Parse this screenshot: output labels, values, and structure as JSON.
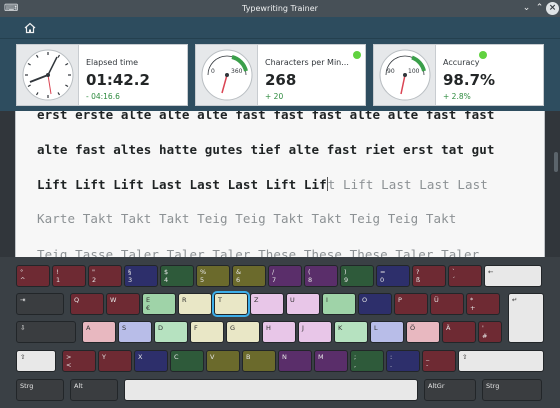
{
  "window": {
    "title": "Typewriting Trainer"
  },
  "stats": {
    "elapsed": {
      "label": "Elapsed time",
      "value": "01:42.2",
      "delta": "- 04:16.6"
    },
    "cpm": {
      "label": "Characters per Min...",
      "value": "268",
      "delta": "+ 20",
      "gauge_ticks": [
        "0",
        "360"
      ],
      "status_color": "#60d23f"
    },
    "accuracy": {
      "label": "Accuracy",
      "value": "98.7%",
      "delta": "+ 2.8%",
      "gauge_ticks": [
        "90",
        "100"
      ],
      "status_color": "#60d23f"
    }
  },
  "lesson": {
    "lines": [
      {
        "typed": "erst erste alte alte alte fast fast fast alte alte fast fast",
        "pending": ""
      },
      {
        "typed": "alte fast altes hatte gutes tief alte fast riet erst tat gut",
        "pending": ""
      },
      {
        "typed": "Lift Lift Lift Last Last Last Lift Lif",
        "pending": "t Lift Last Last Last"
      },
      {
        "typed": "",
        "pending": "Karte Takt Takt Takt Teig Teig Takt Takt Teig Teig Takt"
      },
      {
        "typed": "",
        "pending": "Teig Tasse Taler Taler Taler These These These Taler Taler"
      }
    ]
  },
  "keyboard": {
    "rows": [
      [
        {
          "label": "°",
          "sub": "^",
          "color": "#6e2a33"
        },
        {
          "label": "!",
          "sub": "1",
          "color": "#6e2a33"
        },
        {
          "label": "\"",
          "sub": "2",
          "color": "#6e2a33"
        },
        {
          "label": "§",
          "sub": "3",
          "color": "#2d2f6b"
        },
        {
          "label": "$",
          "sub": "4",
          "color": "#2e5a3a"
        },
        {
          "label": "%",
          "sub": "5",
          "color": "#6b6a2c"
        },
        {
          "label": "&",
          "sub": "6",
          "color": "#6b6a2c"
        },
        {
          "label": "/",
          "sub": "7",
          "color": "#5a2e6a"
        },
        {
          "label": "(",
          "sub": "8",
          "color": "#5a2e6a"
        },
        {
          "label": ")",
          "sub": "9",
          "color": "#2e5a3a"
        },
        {
          "label": "=",
          "sub": "0",
          "color": "#2d2f6b"
        },
        {
          "label": "?",
          "sub": "ß",
          "color": "#6e2a33"
        },
        {
          "label": "`",
          "sub": "´",
          "color": "#6e2a33"
        },
        {
          "label": "←",
          "sub": "",
          "color": "#e8e8e8",
          "light": true
        }
      ],
      [
        {
          "label": "⇥",
          "sub": "",
          "color": "#3a3d40"
        },
        {
          "label": "Q",
          "sub": "",
          "color": "#6e2a33"
        },
        {
          "label": "W",
          "sub": "",
          "color": "#6e2a33"
        },
        {
          "label": "E",
          "sub": "€",
          "color": "#9fd3a8",
          "light": true
        },
        {
          "label": "R",
          "sub": "",
          "color": "#e9e7c6",
          "light": true
        },
        {
          "label": "T",
          "sub": "",
          "color": "#e9e7c6",
          "light": true,
          "active": true
        },
        {
          "label": "Z",
          "sub": "",
          "color": "#e8c6e8",
          "light": true
        },
        {
          "label": "U",
          "sub": "",
          "color": "#e8c6e8",
          "light": true
        },
        {
          "label": "I",
          "sub": "",
          "color": "#9fd3a8",
          "light": true
        },
        {
          "label": "O",
          "sub": "",
          "color": "#2d2f6b"
        },
        {
          "label": "P",
          "sub": "",
          "color": "#6e2a33"
        },
        {
          "label": "Ü",
          "sub": "",
          "color": "#6e2a33"
        },
        {
          "label": "*",
          "sub": "+",
          "color": "#6e2a33"
        },
        {
          "label": "↵",
          "sub": "",
          "color": "#e8e8e8",
          "light": true
        }
      ],
      [
        {
          "label": "⇩",
          "sub": "",
          "color": "#3a3d40"
        },
        {
          "label": "A",
          "sub": "",
          "color": "#e8b8c0",
          "light": true
        },
        {
          "label": "S",
          "sub": "",
          "color": "#b8bde8",
          "light": true
        },
        {
          "label": "D",
          "sub": "",
          "color": "#b6e2c0",
          "light": true
        },
        {
          "label": "F",
          "sub": "",
          "color": "#e9e7c6",
          "light": true
        },
        {
          "label": "G",
          "sub": "",
          "color": "#e9e7c6",
          "light": true
        },
        {
          "label": "H",
          "sub": "",
          "color": "#e8c6e8",
          "light": true
        },
        {
          "label": "J",
          "sub": "",
          "color": "#e8c6e8",
          "light": true
        },
        {
          "label": "K",
          "sub": "",
          "color": "#b6e2c0",
          "light": true
        },
        {
          "label": "L",
          "sub": "",
          "color": "#b8bde8",
          "light": true
        },
        {
          "label": "Ö",
          "sub": "",
          "color": "#e8b8c0",
          "light": true
        },
        {
          "label": "Ä",
          "sub": "",
          "color": "#6e2a33"
        },
        {
          "label": "'",
          "sub": "#",
          "color": "#6e2a33"
        }
      ],
      [
        {
          "label": "⇧",
          "sub": "",
          "color": "#e8e8e8",
          "light": true
        },
        {
          "label": ">",
          "sub": "<",
          "color": "#6e2a33"
        },
        {
          "label": "Y",
          "sub": "",
          "color": "#6e2a33"
        },
        {
          "label": "X",
          "sub": "",
          "color": "#2d2f6b"
        },
        {
          "label": "C",
          "sub": "",
          "color": "#2e5a3a"
        },
        {
          "label": "V",
          "sub": "",
          "color": "#6b6a2c"
        },
        {
          "label": "B",
          "sub": "",
          "color": "#6b6a2c"
        },
        {
          "label": "N",
          "sub": "",
          "color": "#5a2e6a"
        },
        {
          "label": "M",
          "sub": "",
          "color": "#5a2e6a"
        },
        {
          "label": ";",
          "sub": ",",
          "color": "#2e5a3a"
        },
        {
          "label": ":",
          "sub": ".",
          "color": "#2d2f6b"
        },
        {
          "label": "_",
          "sub": "-",
          "color": "#6e2a33"
        },
        {
          "label": "⇧",
          "sub": "",
          "color": "#e8e8e8",
          "light": true
        }
      ],
      [
        {
          "label": "Strg",
          "sub": "",
          "color": "#3a3d40"
        },
        {
          "label": "Alt",
          "sub": "",
          "color": "#3a3d40"
        },
        {
          "label": "",
          "sub": "",
          "color": "#e8e8e8",
          "light": true
        },
        {
          "label": "AltGr",
          "sub": "",
          "color": "#3a3d40"
        },
        {
          "label": "Strg",
          "sub": "",
          "color": "#3a3d40"
        }
      ]
    ]
  }
}
